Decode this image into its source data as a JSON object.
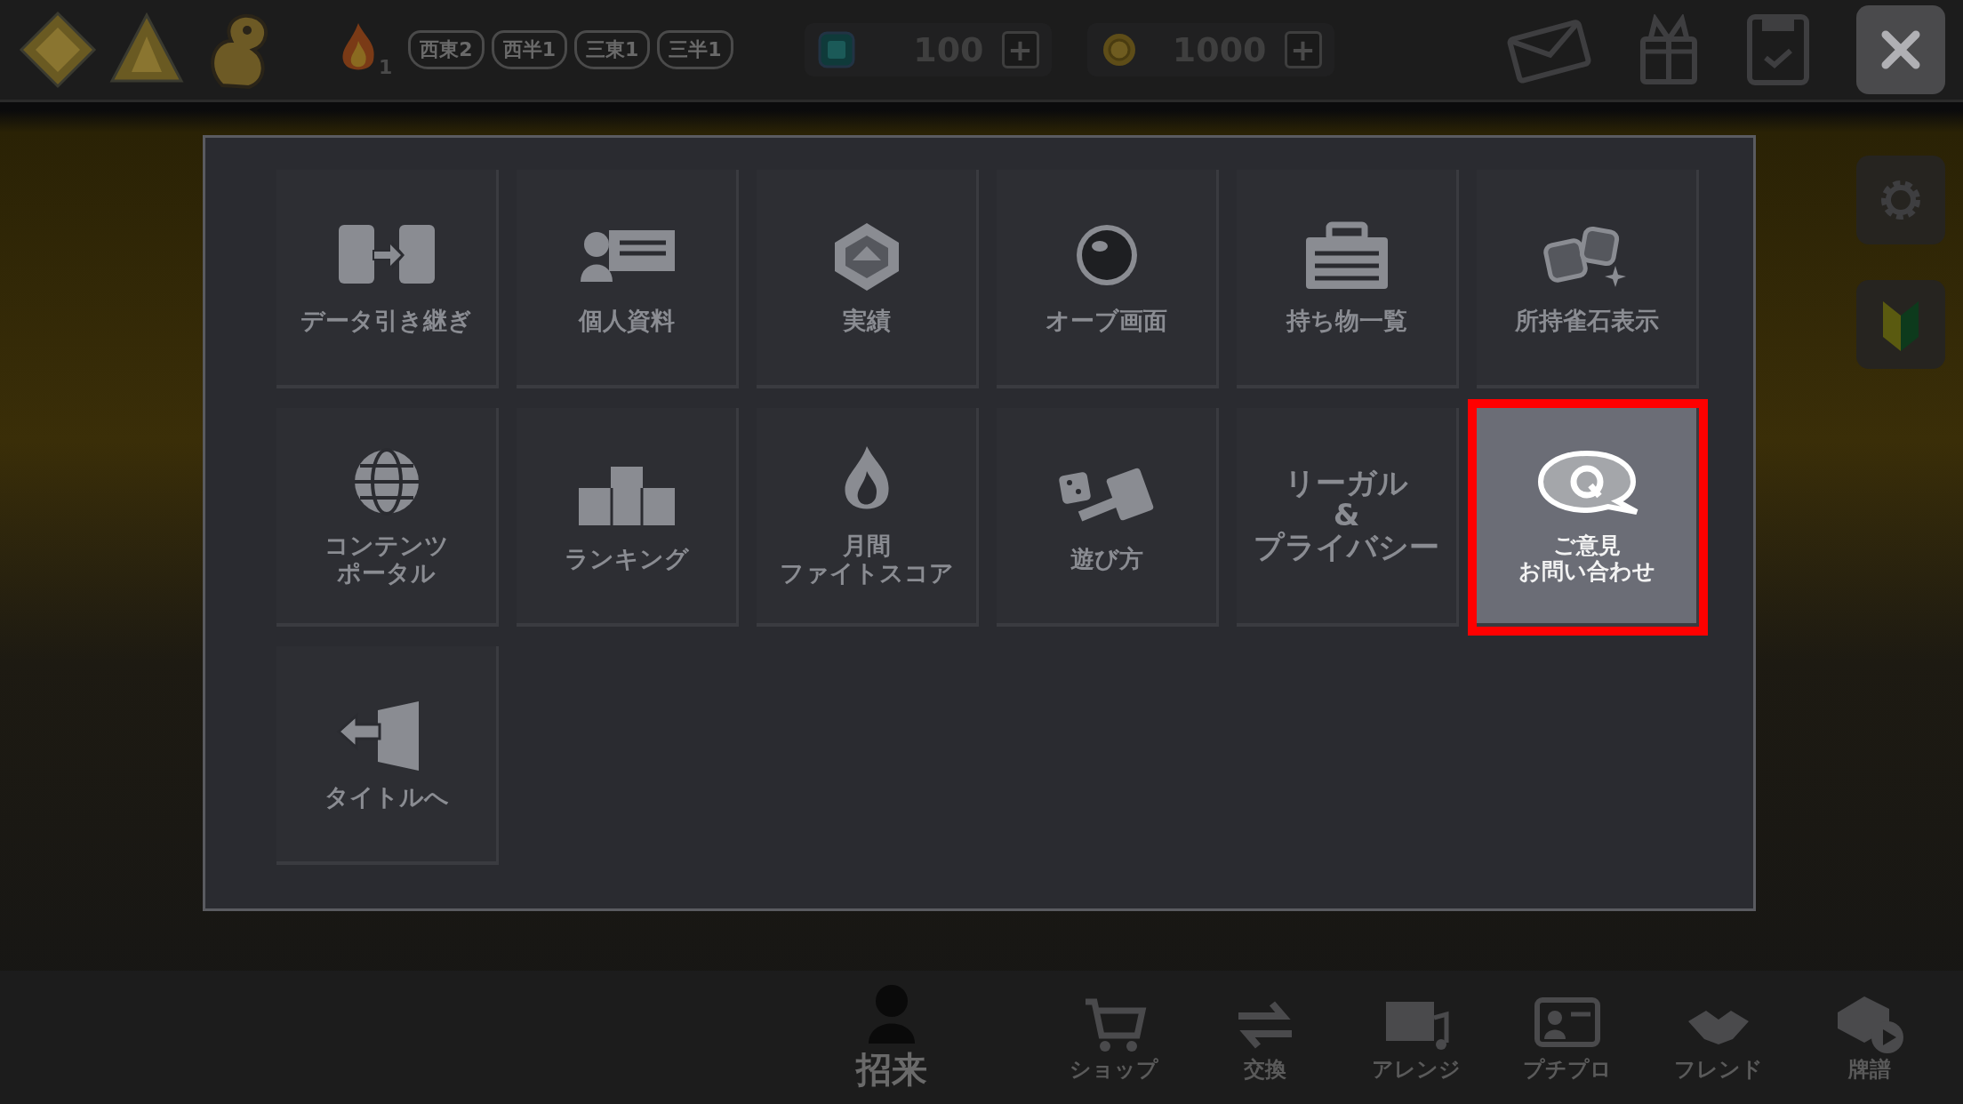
{
  "top_bar": {
    "rank_tags": [
      "西東2",
      "西半1",
      "三東1",
      "三半1"
    ],
    "flame_count": "1",
    "currencies": [
      {
        "kind": "gem",
        "amount": "100",
        "add": "+"
      },
      {
        "kind": "coin",
        "amount": "1000",
        "add": "+"
      }
    ]
  },
  "menu": {
    "items": [
      {
        "kind": "transfer",
        "label": "データ引き継ぎ",
        "selected": false
      },
      {
        "kind": "profile",
        "label": "個人資料",
        "selected": false
      },
      {
        "kind": "achievement",
        "label": "実績",
        "selected": false
      },
      {
        "kind": "orb",
        "label": "オーブ画面",
        "selected": false
      },
      {
        "kind": "inventory",
        "label": "持ち物一覧",
        "selected": false
      },
      {
        "kind": "stones",
        "label": "所持雀石表示",
        "selected": false
      },
      {
        "kind": "portal",
        "label": [
          "コンテンツ",
          "ポータル"
        ],
        "selected": false
      },
      {
        "kind": "ranking",
        "label": "ランキング",
        "selected": false
      },
      {
        "kind": "fight",
        "label": [
          "月間",
          "ファイトスコア"
        ],
        "selected": false
      },
      {
        "kind": "howto",
        "label": "遊び方",
        "selected": false
      },
      {
        "kind": "text",
        "label": [
          "リーガル",
          "&",
          "プライバシー"
        ],
        "selected": false
      },
      {
        "kind": "inquiry",
        "label": [
          "ご意見",
          "お問い合わせ"
        ],
        "selected": true
      },
      {
        "kind": "title",
        "label": "タイトルへ",
        "selected": false
      }
    ]
  },
  "bottom_nav": [
    {
      "kind": "summon",
      "label": "招来"
    },
    {
      "kind": "shop",
      "label": "ショップ"
    },
    {
      "kind": "exchange",
      "label": "交換"
    },
    {
      "kind": "arrange",
      "label": "アレンジ"
    },
    {
      "kind": "petitpro",
      "label": "プチプロ"
    },
    {
      "kind": "friend",
      "label": "フレンド"
    },
    {
      "kind": "replay",
      "label": "牌譜"
    }
  ]
}
